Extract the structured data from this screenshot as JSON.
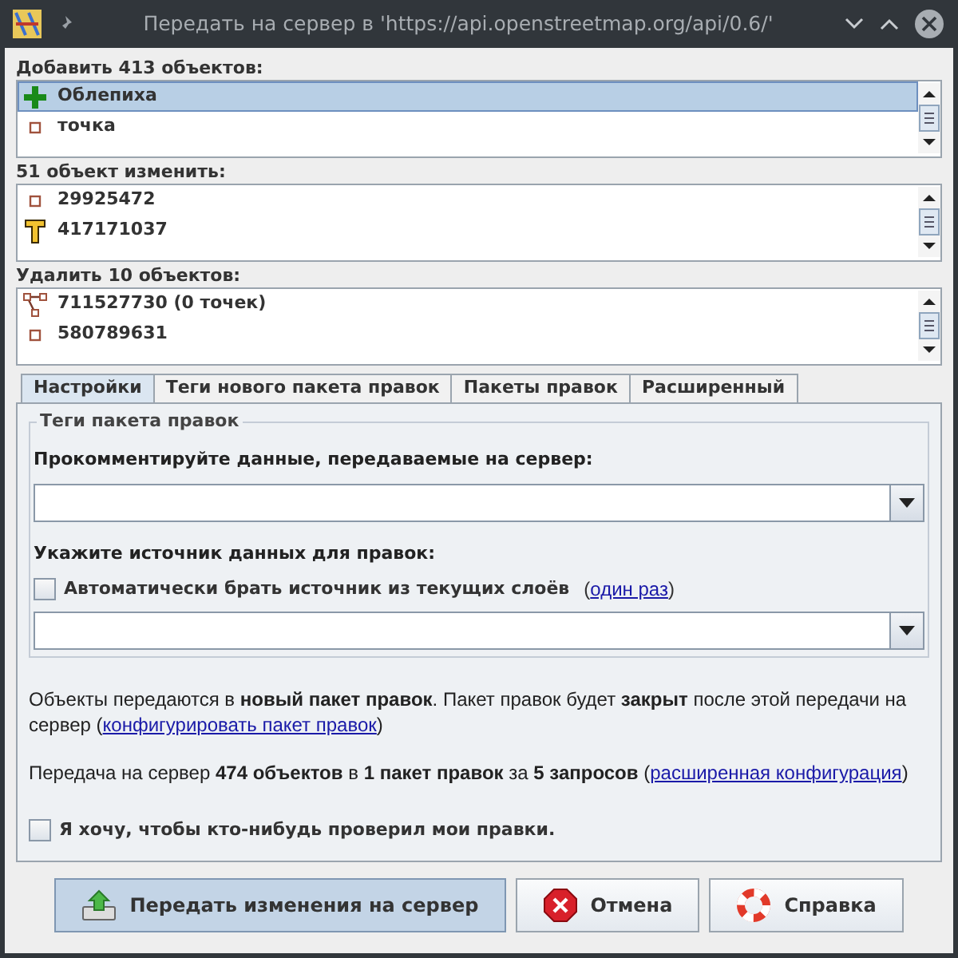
{
  "window": {
    "title": "Передать на сервер в 'https://api.openstreetmap.org/api/0.6/'"
  },
  "lists": [
    {
      "label": "Добавить 413 объектов:",
      "items": [
        {
          "kind": "new",
          "label": "Облепиха",
          "selected": true
        },
        {
          "kind": "node",
          "label": "точка",
          "selected": false
        }
      ]
    },
    {
      "label": "51 объект изменить:",
      "items": [
        {
          "kind": "node",
          "label": "29925472",
          "selected": false
        },
        {
          "kind": "tagged",
          "label": "417171037",
          "selected": false
        }
      ]
    },
    {
      "label": "Удалить 10 объектов:",
      "items": [
        {
          "kind": "way",
          "label": "711527730 (0 точек)",
          "selected": false
        },
        {
          "kind": "node",
          "label": "580789631",
          "selected": false
        }
      ]
    }
  ],
  "tabs": [
    {
      "label": "Настройки",
      "selected": true
    },
    {
      "label": "Теги нового пакета правок",
      "selected": false
    },
    {
      "label": "Пакеты правок",
      "selected": false
    },
    {
      "label": "Расширенный",
      "selected": false
    }
  ],
  "group": {
    "title": "Теги пакета правок",
    "comment_label": "Прокомментируйте данные, передаваемые на сервер:",
    "source_label": "Укажите источник данных для правок:",
    "auto_source": {
      "label": "Автоматически брать источник из текущих слоёв",
      "checked": false,
      "link_open": "(",
      "link": "один раз",
      "link_close": ")"
    }
  },
  "info": [
    {
      "text": "Объекты передаются в **новый пакет правок**. Пакет правок будет **закрыт** после этой передачи на сервер (",
      "link": "конфигурировать пакет правок",
      "after": ")"
    },
    {
      "text": "Передача на сервер **474 объектов** в **1 пакет правок** за **5 запросов** (",
      "link": "расширенная конфигурация",
      "after": ")"
    }
  ],
  "review": {
    "label": "Я хочу, чтобы кто-нибудь проверил мои правки.",
    "checked": false
  },
  "buttons": [
    {
      "kind": "upload",
      "label": "Передать изменения на сервер",
      "default": true
    },
    {
      "kind": "cancel",
      "label": "Отмена",
      "default": false
    },
    {
      "kind": "help",
      "label": "Справка",
      "default": false
    }
  ]
}
